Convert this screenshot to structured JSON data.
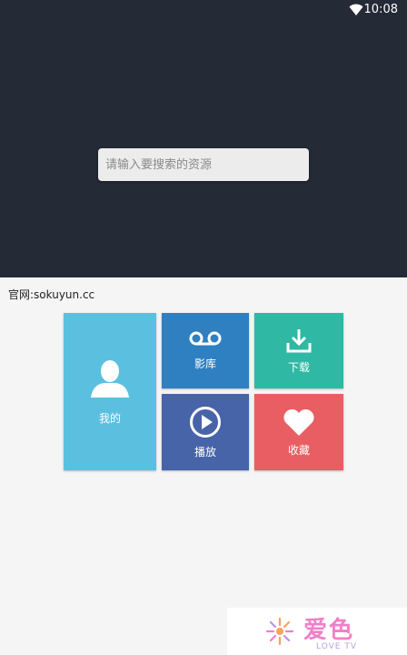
{
  "status_bar": {
    "time": "10:08",
    "wifi_icon": "wifi-icon"
  },
  "search": {
    "placeholder": "请输入要搜索的资源",
    "value": ""
  },
  "site_label": "官网:sokuyun.cc",
  "tiles": {
    "mine": {
      "label": "我的",
      "icon": "user-icon",
      "color": "#5bc0e0"
    },
    "library": {
      "label": "影库",
      "icon": "voicemail-icon",
      "color": "#2f80c1"
    },
    "download": {
      "label": "下载",
      "icon": "download-icon",
      "color": "#2fb8a3"
    },
    "play": {
      "label": "播放",
      "icon": "play-circle-icon",
      "color": "#4764a8"
    },
    "favorites": {
      "label": "收藏",
      "icon": "heart-icon",
      "color": "#e85e62"
    }
  },
  "watermark": {
    "brand": "爱色",
    "sub": "LOVE TV"
  },
  "colors": {
    "header_bg": "#242a36",
    "body_bg": "#f5f5f5"
  }
}
